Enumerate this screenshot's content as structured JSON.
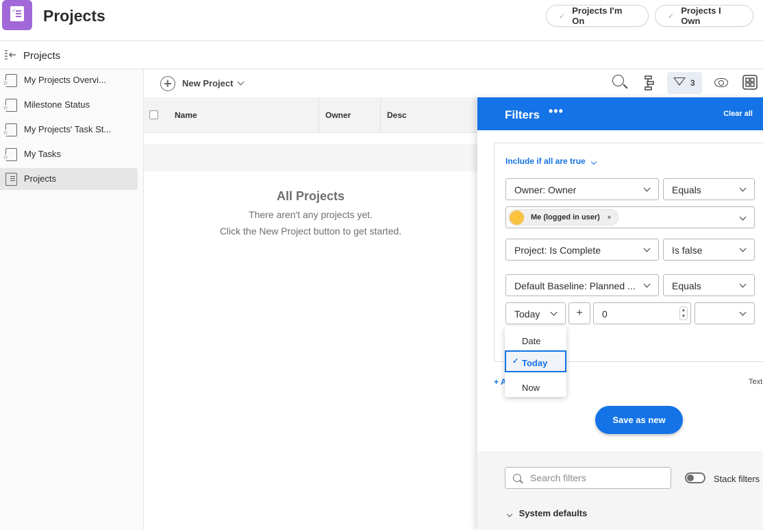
{
  "header": {
    "title": "Projects",
    "pills": [
      "Projects I'm On",
      "Projects I Own"
    ]
  },
  "breadcrumb": {
    "title": "Projects"
  },
  "sidebar": {
    "items": [
      {
        "label": "My Projects Overvi...",
        "active": false
      },
      {
        "label": "Milestone Status",
        "active": false
      },
      {
        "label": "My Projects' Task St...",
        "active": false
      },
      {
        "label": "My Tasks",
        "active": false
      },
      {
        "label": "Projects",
        "active": true
      }
    ]
  },
  "toolbar": {
    "new_project_label": "New Project",
    "filter_count": "3"
  },
  "table": {
    "columns": [
      "Name",
      "Owner",
      "Desc"
    ]
  },
  "empty_state": {
    "title": "All Projects",
    "line1": "There aren't any projects yet.",
    "line2": "Click the New Project button to get started."
  },
  "filters": {
    "title": "Filters",
    "more": "•••",
    "clear_all": "Clear all",
    "include_mode": "Include if all are true",
    "rule1": {
      "field": "Owner: Owner",
      "operator": "Equals",
      "value_tag": "Me (logged in user)",
      "tag_remove": "×"
    },
    "rule2": {
      "field": "Project: Is Complete",
      "operator": "Is false"
    },
    "rule3": {
      "field": "Default Baseline: Planned ...",
      "operator": "Equals",
      "relative": "Today",
      "plus": "+",
      "offset": "0",
      "unit": ""
    },
    "dropdown_options": [
      "Date",
      "Today",
      "Now"
    ],
    "dropdown_selected": "Today",
    "add_link": "+ A",
    "text_link": "Text",
    "save_button": "Save as new",
    "search_placeholder": "Search filters",
    "stack_filters_label": "Stack filters",
    "stack_filters_on": false,
    "system_defaults": "System defaults"
  },
  "colors": {
    "accent": "#1473e6",
    "app_icon": "#a168d8",
    "user_badge": "#f8c244"
  },
  "icons": [
    "app-icon",
    "collapse-sidebar-icon",
    "plus-circle-icon",
    "search-icon",
    "hierarchy-icon",
    "filter-icon",
    "eye-icon",
    "grid-icon",
    "lightning-icon",
    "check-icon"
  ]
}
